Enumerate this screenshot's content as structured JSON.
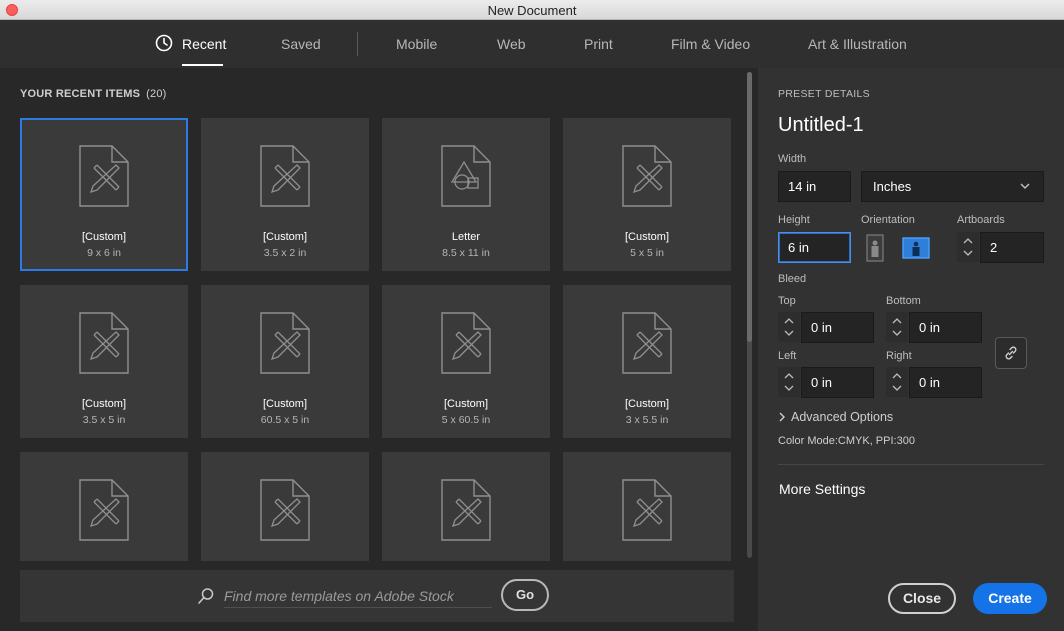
{
  "window": {
    "title": "New Document"
  },
  "tabs": [
    {
      "label": "Recent"
    },
    {
      "label": "Saved"
    },
    {
      "label": "Mobile"
    },
    {
      "label": "Web"
    },
    {
      "label": "Print"
    },
    {
      "label": "Film & Video"
    },
    {
      "label": "Art & Illustration"
    }
  ],
  "recent": {
    "header": "YOUR RECENT ITEMS",
    "count": "(20)",
    "items": [
      {
        "name": "[Custom]",
        "size": "9 x 6 in",
        "icon": "custom-doc-icon"
      },
      {
        "name": "[Custom]",
        "size": "3.5 x 2 in",
        "icon": "custom-doc-icon"
      },
      {
        "name": "Letter",
        "size": "8.5 x 11 in",
        "icon": "shapes-doc-icon"
      },
      {
        "name": "[Custom]",
        "size": "5 x 5 in",
        "icon": "custom-doc-icon"
      },
      {
        "name": "[Custom]",
        "size": "3.5 x 5 in",
        "icon": "custom-doc-icon"
      },
      {
        "name": "[Custom]",
        "size": "60.5 x 5 in",
        "icon": "custom-doc-icon"
      },
      {
        "name": "[Custom]",
        "size": "5 x 60.5 in",
        "icon": "custom-doc-icon"
      },
      {
        "name": "[Custom]",
        "size": "3 x 5.5 in",
        "icon": "custom-doc-icon"
      },
      {
        "name": "",
        "size": "",
        "icon": "custom-doc-icon"
      },
      {
        "name": "",
        "size": "",
        "icon": "custom-doc-icon"
      },
      {
        "name": "",
        "size": "",
        "icon": "custom-doc-icon"
      },
      {
        "name": "",
        "size": "",
        "icon": "custom-doc-icon"
      }
    ]
  },
  "search": {
    "placeholder": "Find more templates on Adobe Stock",
    "go_label": "Go"
  },
  "preset": {
    "section_label": "PRESET DETAILS",
    "doc_name": "Untitled-1",
    "width_label": "Width",
    "width_value": "14 in",
    "units": "Inches",
    "height_label": "Height",
    "height_value": "6 in",
    "orientation_label": "Orientation",
    "artboards_label": "Artboards",
    "artboards_value": "2",
    "bleed_label": "Bleed",
    "top_label": "Top",
    "top_value": "0 in",
    "bottom_label": "Bottom",
    "bottom_value": "0 in",
    "left_label": "Left",
    "left_value": "0 in",
    "right_label": "Right",
    "right_value": "0 in",
    "advanced_label": "Advanced Options",
    "color_mode": "Color Mode:CMYK, PPI:300",
    "more_settings": "More Settings"
  },
  "actions": {
    "close_label": "Close",
    "create_label": "Create"
  },
  "colors": {
    "accent": "#1473e6",
    "selected_border": "#2e79e6",
    "orientation_active": "#2d8ceb"
  }
}
